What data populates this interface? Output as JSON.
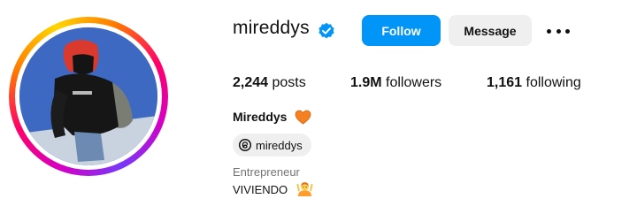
{
  "profile": {
    "username": "mireddys",
    "verified": true,
    "full_name": "Mireddys",
    "name_emoji": "orange-heart-icon",
    "category": "Entrepreneur",
    "bio": "VIVIENDO",
    "bio_emoji": "person-gesturing-ok-icon"
  },
  "actions": {
    "follow_label": "Follow",
    "message_label": "Message",
    "more_icon": "more-options-icon"
  },
  "stats": {
    "posts_value": "2,244",
    "posts_label": "posts",
    "followers_value": "1.9M",
    "followers_label": "followers",
    "following_value": "1,161",
    "following_label": "following"
  },
  "threads": {
    "handle": "mireddys",
    "icon": "threads-icon"
  },
  "colors": {
    "primary_button": "#0095f6",
    "secondary_button": "#efefef",
    "verified_badge": "#0095f6",
    "muted_text": "#737373",
    "heart": "#f4801f"
  }
}
